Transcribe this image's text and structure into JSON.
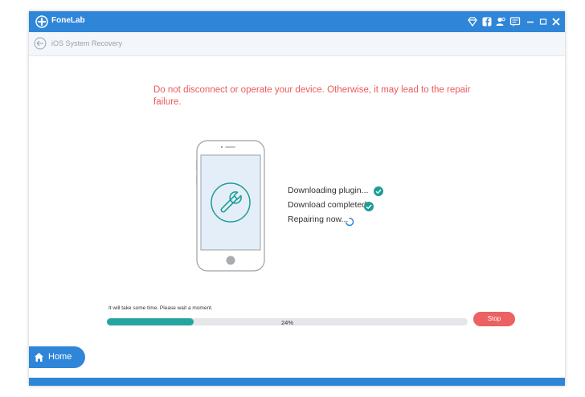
{
  "titlebar": {
    "app_name": "FoneLab",
    "icons": [
      "diamond-icon",
      "facebook-icon",
      "user-icon",
      "feedback-icon",
      "minimize-icon",
      "maximize-icon",
      "close-icon"
    ]
  },
  "subbar": {
    "title": "iOS System Recovery"
  },
  "warning": "Do not disconnect or operate your device. Otherwise, it may lead to the repair failure.",
  "status": [
    {
      "label": "Downloading plugin...",
      "icon": "check-icon"
    },
    {
      "label": "Download completed.",
      "icon": "check-icon"
    },
    {
      "label": "Repairing now...",
      "icon": "spinner-icon"
    }
  ],
  "progress": {
    "caption": "It will take some time. Please wait a moment.",
    "value": 0.24,
    "label": "24%"
  },
  "stop_label": "Stop",
  "home_label": "Home",
  "colors": {
    "brand": "#2f86d9",
    "warning_text": "#ec5a5a",
    "progress_fill": "#26a5a0",
    "stop_button": "#ec6161",
    "check": "#1f9c96"
  }
}
